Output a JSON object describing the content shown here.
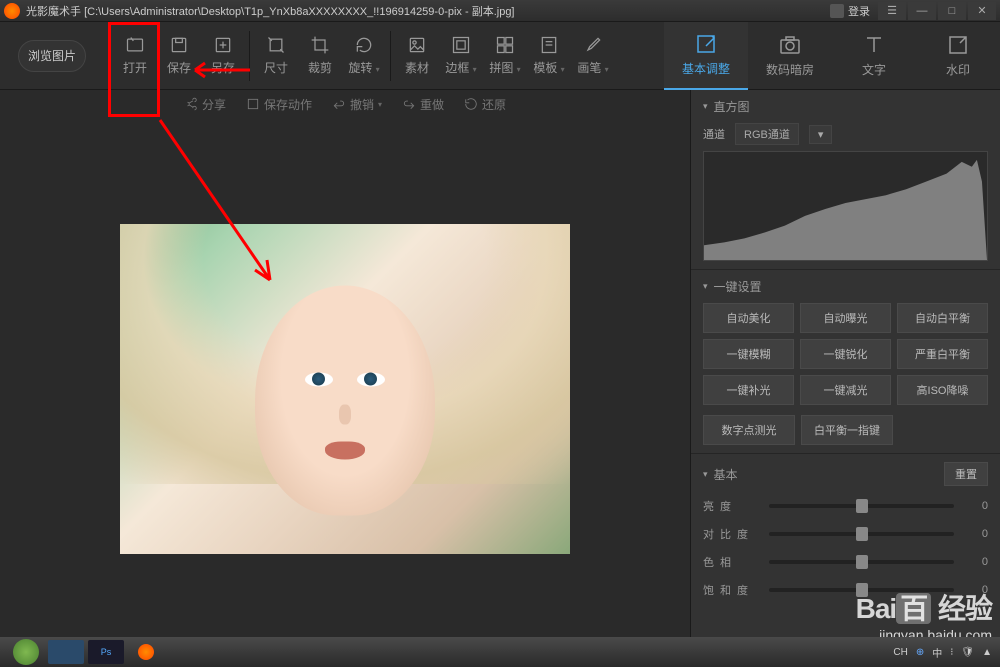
{
  "titlebar": {
    "app_name": "光影魔术手",
    "file_path": "[C:\\Users\\Administrator\\Desktop\\T1p_YnXb8aXXXXXXXX_!!196914259-0-pix - 副本.jpg]",
    "login": "登录"
  },
  "toolbar": {
    "browse": "浏览图片",
    "open": "打开",
    "save": "保存",
    "save_as": "另存",
    "size": "尺寸",
    "crop": "裁剪",
    "rotate": "旋转",
    "material": "素材",
    "frame": "边框",
    "collage": "拼图",
    "template": "模板",
    "brush": "画笔"
  },
  "mode_tabs": {
    "basic": "基本调整",
    "darkroom": "数码暗房",
    "text": "文字",
    "watermark": "水印"
  },
  "action_bar": {
    "share": "分享",
    "save_action": "保存动作",
    "undo": "撤销",
    "redo": "重做",
    "restore": "还原"
  },
  "panel": {
    "histogram": {
      "title": "直方图",
      "channel_label": "通道",
      "channel_value": "RGB通道"
    },
    "one_click": {
      "title": "一键设置",
      "buttons": [
        "自动美化",
        "自动曝光",
        "自动白平衡",
        "一键模糊",
        "一键锐化",
        "严重白平衡",
        "一键补光",
        "一键减光",
        "高ISO降噪"
      ],
      "buttons2": [
        "数字点测光",
        "白平衡一指键"
      ]
    },
    "basic": {
      "title": "基本",
      "reset": "重置",
      "sliders": [
        {
          "label": "亮度",
          "value": 0
        },
        {
          "label": "对比度",
          "value": 0
        },
        {
          "label": "色相",
          "value": 0
        },
        {
          "label": "饱和度",
          "value": 0
        }
      ]
    }
  },
  "taskbar": {
    "lang": "CH",
    "ime": "中"
  },
  "watermark": {
    "logo": "Bai",
    "logo2": "百",
    "sub": "经验",
    "url": "jingyan.baidu.com"
  }
}
